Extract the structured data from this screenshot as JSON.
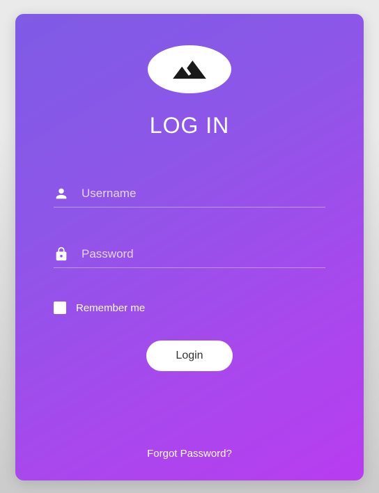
{
  "title": "LOG IN",
  "username": {
    "placeholder": "Username",
    "value": ""
  },
  "password": {
    "placeholder": "Password",
    "value": ""
  },
  "remember": {
    "label": "Remember me",
    "checked": false
  },
  "loginButton": "Login",
  "forgotLink": "Forgot Password?"
}
